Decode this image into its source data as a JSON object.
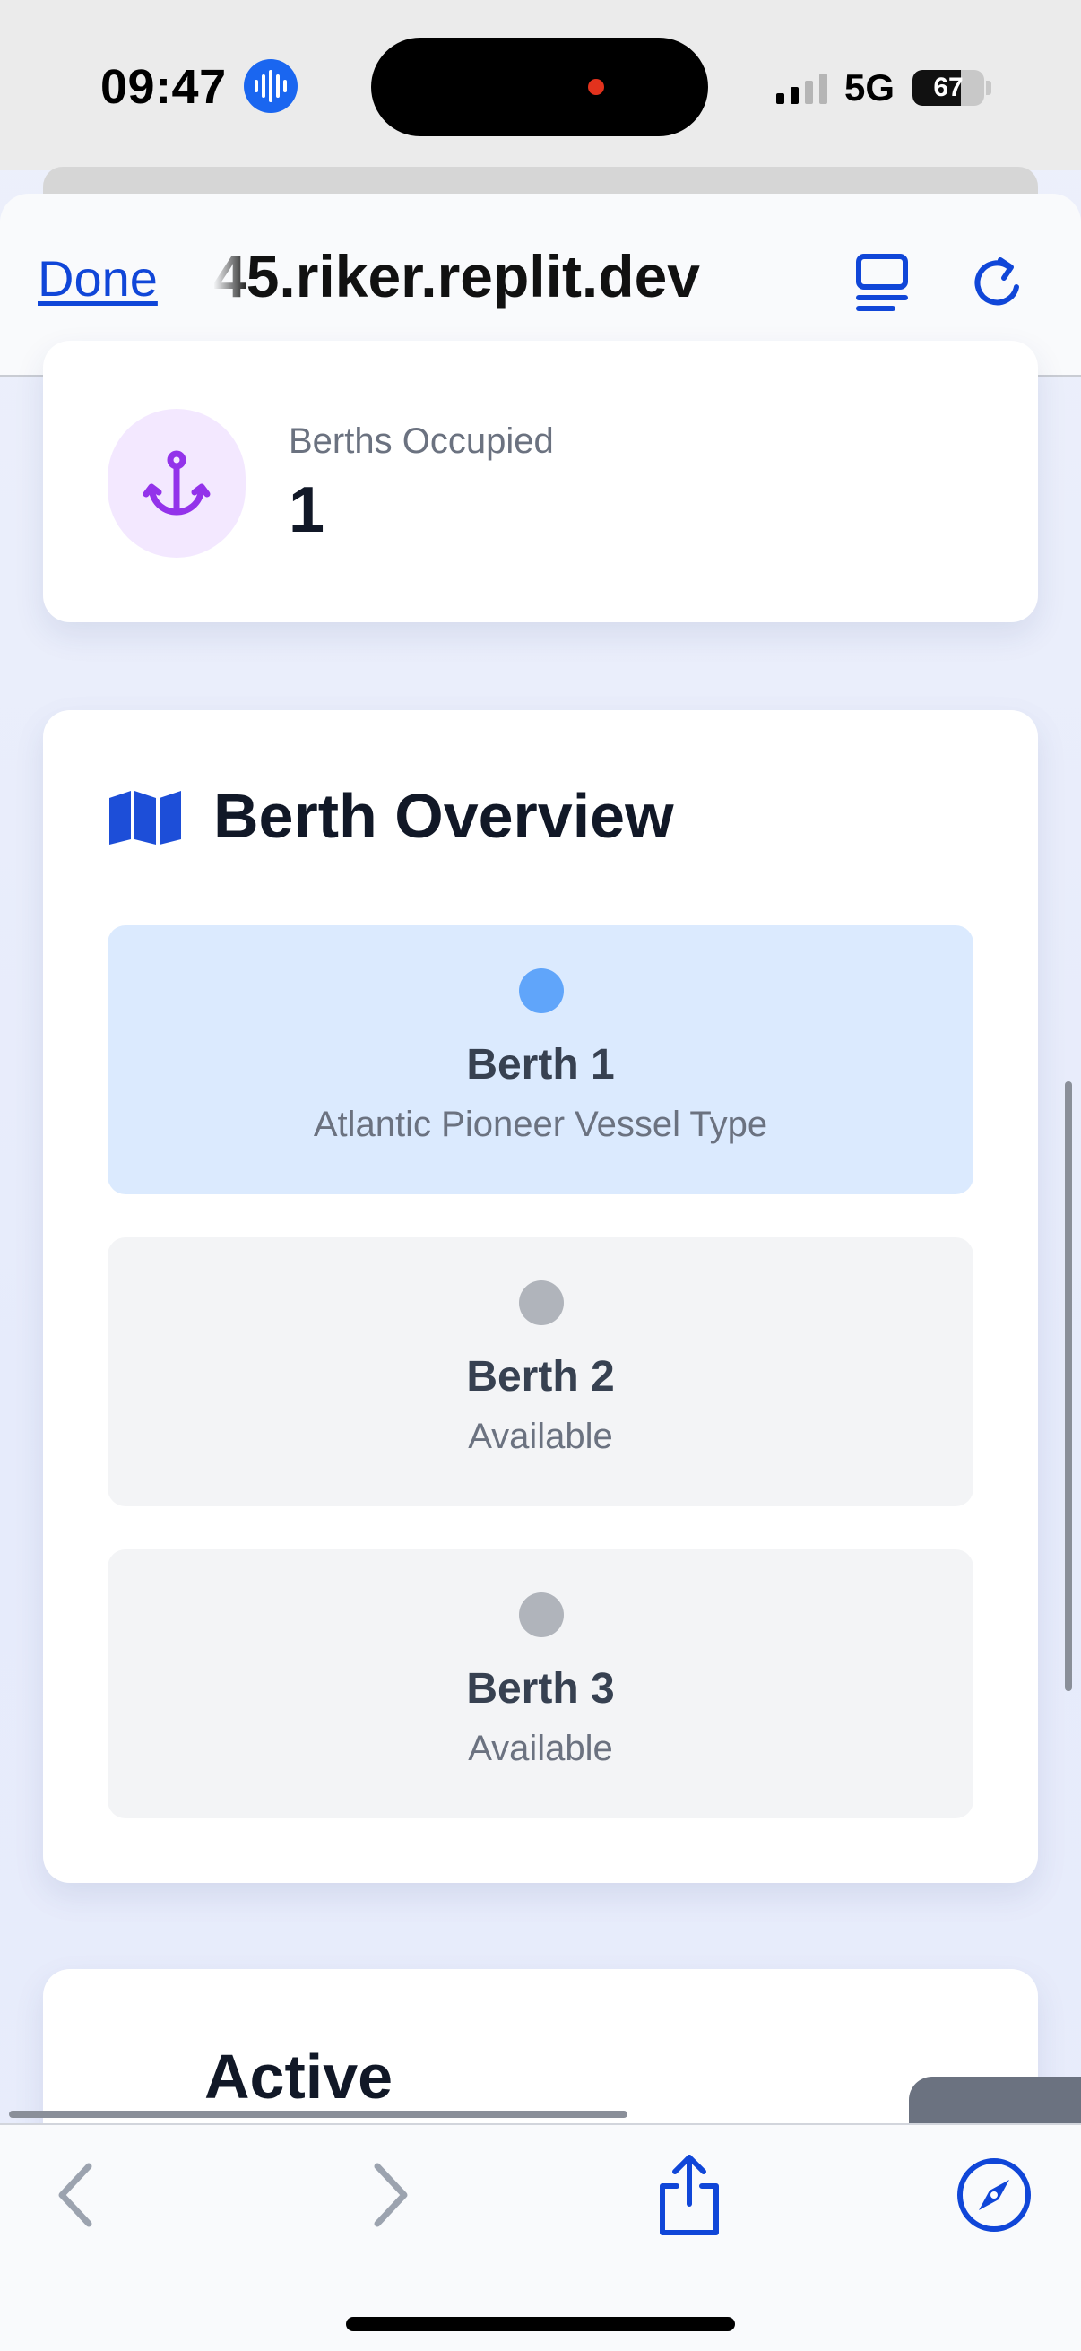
{
  "status_bar": {
    "time": "09:47",
    "network": "5G",
    "battery": "67"
  },
  "browser": {
    "done_label": "Done",
    "url": "45.riker.replit.dev"
  },
  "stats": {
    "label": "Berths Occupied",
    "value": "1",
    "icon": "anchor-icon",
    "icon_color": "#9333ea"
  },
  "berth_overview": {
    "title": "Berth Overview",
    "icon": "map-icon",
    "berths": [
      {
        "name": "Berth 1",
        "status": "Atlantic Pioneer Vessel Type",
        "state": "occupied",
        "bg": "#dbeafe",
        "dot": "#60a5fa"
      },
      {
        "name": "Berth 2",
        "status": "Available",
        "state": "available",
        "bg": "#f3f4f6",
        "dot": "#b0b4bb"
      },
      {
        "name": "Berth 3",
        "status": "Available",
        "state": "available",
        "bg": "#f3f4f6",
        "dot": "#b0b4bb"
      }
    ]
  },
  "active_section": {
    "title": "Active"
  },
  "toolbar": {
    "icons": [
      "back-icon",
      "forward-icon",
      "share-icon",
      "compass-icon"
    ]
  },
  "colors": {
    "accent": "#1046d8",
    "purple": "#9333ea",
    "title_blue": "#1d4ed8"
  }
}
